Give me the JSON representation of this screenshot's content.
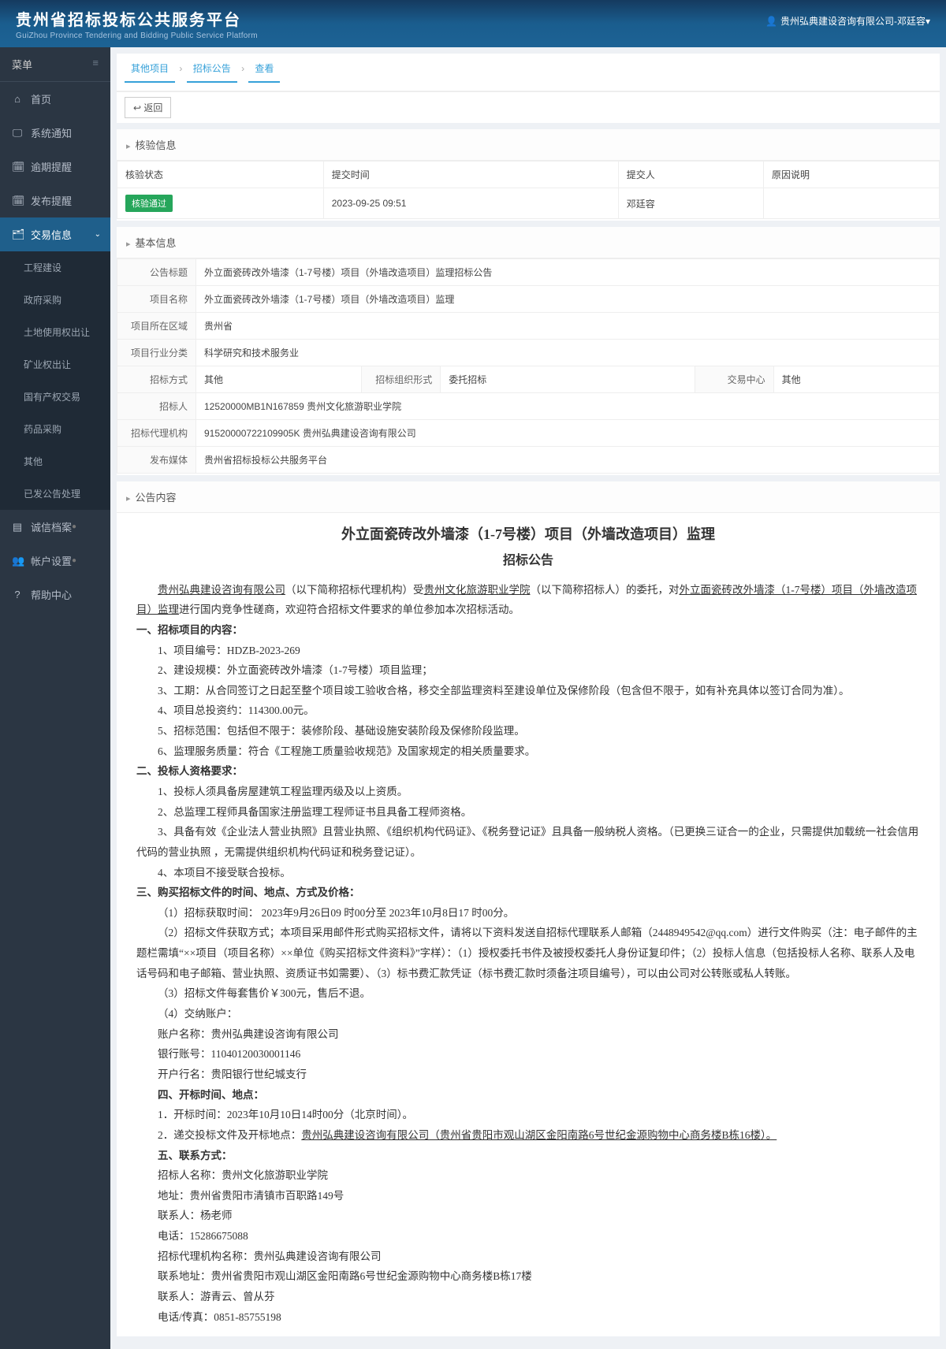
{
  "header": {
    "title": "贵州省招标投标公共服务平台",
    "sub": "GuiZhou Province Tendering and Bidding Public Service Platform",
    "user": "贵州弘典建设咨询有限公司-邓廷容▾"
  },
  "sidebar": {
    "header": "菜单",
    "items": [
      {
        "icon": "⌂",
        "label": "首页"
      },
      {
        "icon": "🖵",
        "label": "系统通知"
      },
      {
        "icon": "🗓",
        "label": "逾期提醒"
      },
      {
        "icon": "🗓",
        "label": "发布提醒"
      },
      {
        "icon": "🗂",
        "label": "交易信息"
      },
      {
        "icon": "▤",
        "label": "诚信档案"
      },
      {
        "icon": "👥",
        "label": "帐户设置"
      },
      {
        "icon": "?",
        "label": "帮助中心"
      }
    ],
    "sub": [
      "工程建设",
      "政府采购",
      "土地使用权出让",
      "矿业权出让",
      "国有产权交易",
      "药品采购",
      "其他",
      "已发公告处理"
    ]
  },
  "breadcrumb": {
    "a": "其他项目",
    "b": "招标公告",
    "c": "查看"
  },
  "back": "↩ 返回",
  "verify": {
    "title": "核验信息",
    "th1": "核验状态",
    "th2": "提交时间",
    "th3": "提交人",
    "th4": "原因说明",
    "status": "核验通过",
    "time": "2023-09-25 09:51",
    "person": "邓廷容",
    "reason": ""
  },
  "basic": {
    "title": "基本信息",
    "l1": "公告标题",
    "v1": "外立面瓷砖改外墙漆（1-7号楼）项目（外墙改造项目）监理招标公告",
    "l2": "项目名称",
    "v2": "外立面瓷砖改外墙漆（1-7号楼）项目（外墙改造项目）监理",
    "l3": "项目所在区域",
    "v3": "贵州省",
    "l4": "项目行业分类",
    "v4": "科学研究和技术服务业",
    "l5": "招标方式",
    "v5": "其他",
    "l6": "招标组织形式",
    "v6": "委托招标",
    "l7": "交易中心",
    "v7": "其他",
    "l8": "招标人",
    "v8": "12520000MB1N167859 贵州文化旅游职业学院",
    "l9": "招标代理机构",
    "v9": "91520000722109905K 贵州弘典建设咨询有限公司",
    "l10": "发布媒体",
    "v10": "贵州省招标投标公共服务平台"
  },
  "content": {
    "panelTitle": "公告内容",
    "h2": "外立面瓷砖改外墙漆（1-7号楼）项目（外墙改造项目）监理",
    "h3": "招标公告",
    "intro_a": "贵州弘典建设咨询有限公司",
    "intro_b": "（以下简称招标代理机构）受",
    "intro_c": "贵州文化旅游职业学院",
    "intro_d": "（以下简称招标人）的委托，对",
    "intro_e": "外立面瓷砖改外墙漆（1-7号楼）项目（外墙改造项目）监理",
    "intro_f": "进行国内竞争性磋商，欢迎符合招标文件要求的单位参加本次招标活动。",
    "s1": "一、招标项目的内容：",
    "s1_1": "1、项目编号：HDZB-2023-269",
    "s1_2": "2、建设规模：外立面瓷砖改外墙漆（1-7号楼）项目监理；",
    "s1_3": "3、工期：从合同签订之日起至整个项目竣工验收合格，移交全部监理资料至建设单位及保修阶段（包含但不限于，如有补充具体以签订合同为准）。",
    "s1_4": "4、项目总投资约：114300.00元。",
    "s1_5": "5、招标范围：包括但不限于：装修阶段、基础设施安装阶段及保修阶段监理。",
    "s1_6": "6、监理服务质量：符合《工程施工质量验收规范》及国家规定的相关质量要求。",
    "s2": "二、投标人资格要求：",
    "s2_1": "1、投标人须具备房屋建筑工程监理丙级及以上资质。",
    "s2_2": "2、总监理工程师具备国家注册监理工程师证书且具备工程师资格。",
    "s2_3": "3、具备有效《企业法人营业执照》且营业执照、《组织机构代码证》、《税务登记证》且具备一般纳税人资格。（已更换三证合一的企业，只需提供加载统一社会信用代码的营业执照 ，无需提供组织机构代码证和税务登记证）。",
    "s2_4": "4、本项目不接受联合投标。",
    "s3": "三、购买招标文件的时间、地点、方式及价格：",
    "s3_1": "（1）招标获取时间： 2023年9月26日09   时00分至  2023年10月8日17   时00分。",
    "s3_2": "（2）招标文件获取方式；本项目采用邮件形式购买招标文件，请将以下资料发送自招标代理联系人邮箱（2448949542@qq.com）进行文件购买（注：电子邮件的主题栏需填“××项目（项目名称）××单位《购买招标文件资料》”字样）：（1）授权委托书件及被授权委托人身份证复印件；（2）投标人信息（包括投标人名称、联系人及电话号码和电子邮箱、营业执照、资质证书如需要）、（3）标书费汇款凭证（标书费汇款时须备注项目编号），可以由公司对公转账或私人转账。",
    "s3_3": "（3）招标文件每套售价￥300元，售后不退。",
    "s3_4": "（4）交纳账户：",
    "s3_5": "账户名称：贵州弘典建设咨询有限公司",
    "s3_6": "银行账号：11040120030001146",
    "s3_7": "开户行名：贵阳银行世纪城支行",
    "s4": "四、开标时间、地点：",
    "s4_1": "1．开标时间：2023年10月10日14时00分（北京时间）。",
    "s4_2a": "2．递交投标文件及开标地点：",
    "s4_2b": "贵州弘典建设咨询有限公司（贵州省贵阳市观山湖区金阳南路6号世纪金源购物中心商务楼B栋16楼）。",
    "s5": "五、联系方式：",
    "s5_1": "招标人名称：贵州文化旅游职业学院",
    "s5_2": "地址：贵州省贵阳市清镇市百职路149号",
    "s5_3": "联系人：杨老师",
    "s5_4": "电话：15286675088",
    "s5_5": "招标代理机构名称：贵州弘典建设咨询有限公司",
    "s5_6": "联系地址：贵州省贵阳市观山湖区金阳南路6号世纪金源购物中心商务楼B栋17楼",
    "s5_7": "联系人：游青云、曾从芬",
    "s5_8": "电话/传真：0851-85755198"
  }
}
